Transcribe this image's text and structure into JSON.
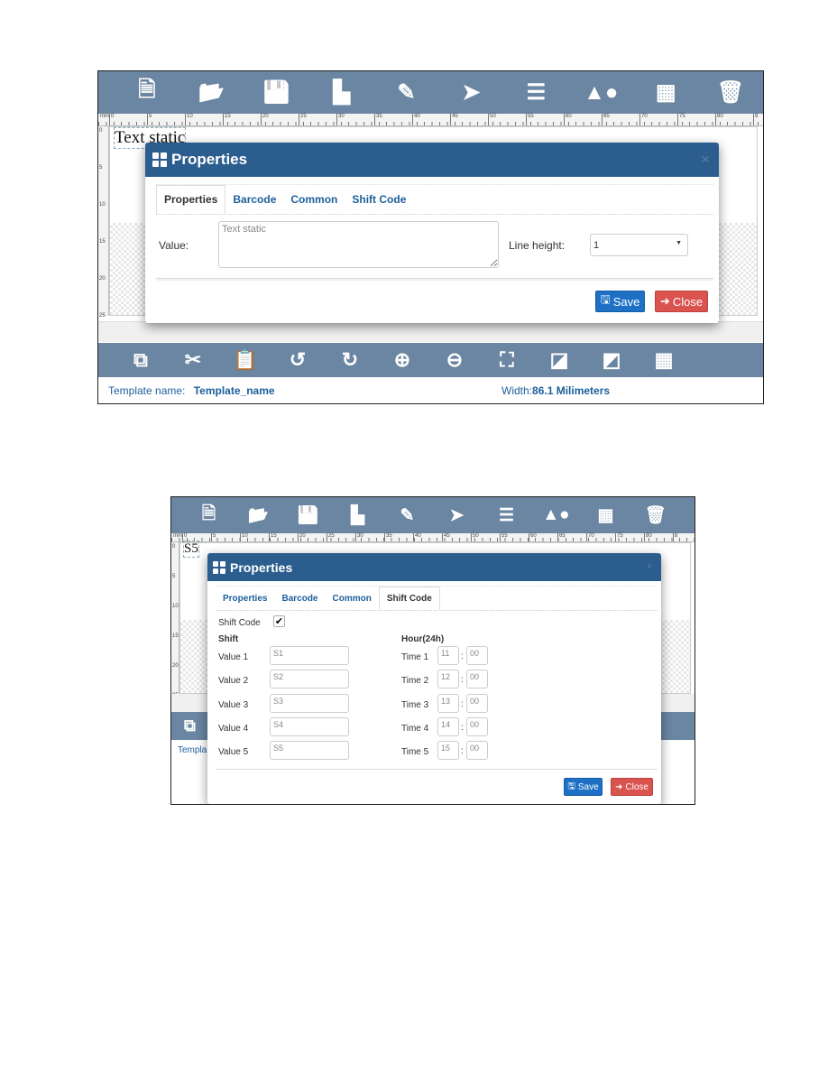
{
  "toolbar_icons": [
    "new-file-icon",
    "open-folder-icon",
    "save-icon",
    "save-as-icon",
    "edit-icon",
    "pointer-icon",
    "list-icon",
    "shapes-icon",
    "calculator-icon",
    "trash-icon"
  ],
  "toolbar_glyphs": [
    "🗎",
    "📂",
    "💾",
    "▙",
    "✎",
    "➤",
    "☰",
    "▲●",
    "▦",
    "🗑"
  ],
  "bottom_icons": [
    "copy-icon",
    "cut-icon",
    "paste-icon",
    "undo-icon",
    "redo-icon",
    "zoom-in-icon",
    "zoom-out-icon",
    "fit-icon",
    "send-back-icon",
    "bring-front-icon",
    "grid-icon"
  ],
  "bottom_glyphs": [
    "⧉",
    "✂",
    "📋",
    "↺",
    "↻",
    "⊕",
    "⊖",
    "⛶",
    "◪",
    "◩",
    "▦"
  ],
  "ruler": {
    "unit": "mm",
    "h": [
      "0",
      "5",
      "10",
      "15",
      "20",
      "25",
      "30",
      "35",
      "40",
      "45",
      "50",
      "55",
      "60",
      "65",
      "70",
      "75",
      "80",
      "8"
    ],
    "v": [
      "0",
      "5",
      "10",
      "15",
      "20",
      "25"
    ]
  },
  "colors": {
    "toolbar": "#6b86a2",
    "modal_header": "#2b5d8e",
    "save": "#1d70c4",
    "close": "#d9534f",
    "tab_link": "#1d5f9c"
  },
  "shot1": {
    "canvas_text": "Text static",
    "modal": {
      "title": "Properties",
      "close": "×",
      "tabs": [
        "Properties",
        "Barcode",
        "Common",
        "Shift Code"
      ],
      "active_tab": "Properties",
      "value_label": "Value:",
      "value": "Text static",
      "line_height_label": "Line height:",
      "line_height": "1",
      "save": "Save",
      "close_btn": "Close"
    },
    "footer": {
      "template_label": "Template name:",
      "template_name": "Template_name",
      "width_label": "Width:",
      "width_value": "86.1 Milimeters"
    }
  },
  "shot2": {
    "canvas_text": "S5",
    "footer_partial": "Templa",
    "modal": {
      "title": "Properties",
      "close": "×",
      "tabs": [
        "Properties",
        "Barcode",
        "Common",
        "Shift Code"
      ],
      "active_tab": "Shift Code",
      "shift_code_label": "Shift Code",
      "shift_code_checked": true,
      "shift_heading": "Shift",
      "hour_heading": "Hour(24h)",
      "rows": [
        {
          "value_label": "Value 1",
          "value": "S1",
          "time_label": "Time 1",
          "hour": "11",
          "minute": "00"
        },
        {
          "value_label": "Value 2",
          "value": "S2",
          "time_label": "Time 2",
          "hour": "12",
          "minute": "00"
        },
        {
          "value_label": "Value 3",
          "value": "S3",
          "time_label": "Time 3",
          "hour": "13",
          "minute": "00"
        },
        {
          "value_label": "Value 4",
          "value": "S4",
          "time_label": "Time 4",
          "hour": "14",
          "minute": "00"
        },
        {
          "value_label": "Value 5",
          "value": "S5",
          "time_label": "Time 5",
          "hour": "15",
          "minute": "00"
        }
      ],
      "colon": ":",
      "save": "Save",
      "close_btn": "Close"
    }
  }
}
